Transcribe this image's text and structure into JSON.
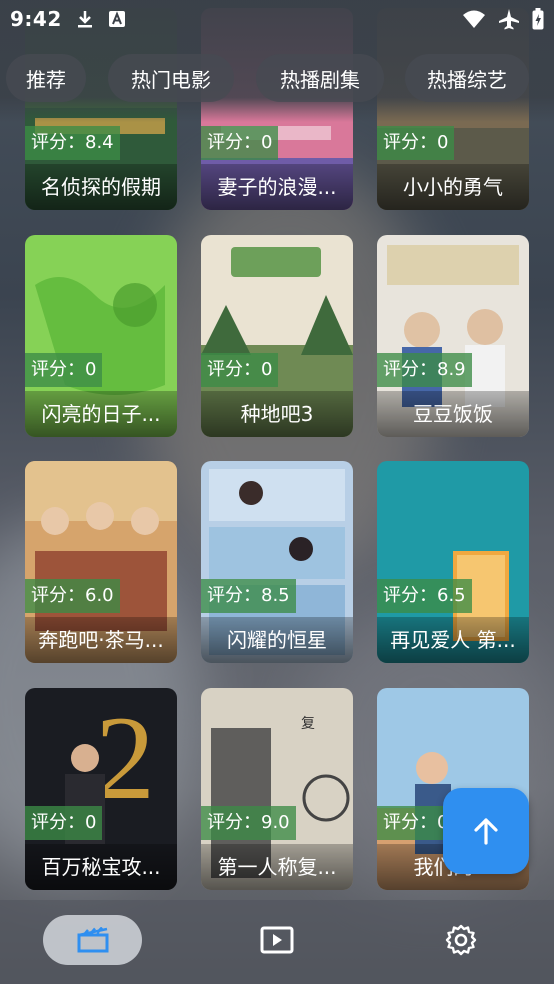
{
  "status": {
    "time": "9:42"
  },
  "tabs": [
    {
      "label": "推荐"
    },
    {
      "label": "热门电影"
    },
    {
      "label": "热播剧集"
    },
    {
      "label": "热播综艺"
    }
  ],
  "cards": [
    {
      "rating": "评分：8.4",
      "title": "名侦探的假期"
    },
    {
      "rating": "评分：0",
      "title": "妻子的浪漫..."
    },
    {
      "rating": "评分：0",
      "title": "小小的勇气"
    },
    {
      "rating": "评分：0",
      "title": "闪亮的日子..."
    },
    {
      "rating": "评分：0",
      "title": "种地吧3"
    },
    {
      "rating": "评分：8.9",
      "title": "豆豆饭饭"
    },
    {
      "rating": "评分：6.0",
      "title": "奔跑吧·茶马..."
    },
    {
      "rating": "评分：8.5",
      "title": "闪耀的恒星"
    },
    {
      "rating": "评分：6.5",
      "title": "再见爱人 第..."
    },
    {
      "rating": "评分：0",
      "title": "百万秘宝攻..."
    },
    {
      "rating": "评分：9.0",
      "title": "第一人称复..."
    },
    {
      "rating": "评分：0",
      "title": "我们的..."
    }
  ],
  "colors": {
    "accent": "#2f8ff0",
    "rating_bg": "#3c8c46"
  },
  "icons": {
    "fab": "arrow-up-icon",
    "nav": [
      "movie-icon",
      "play-icon",
      "settings-icon"
    ]
  }
}
